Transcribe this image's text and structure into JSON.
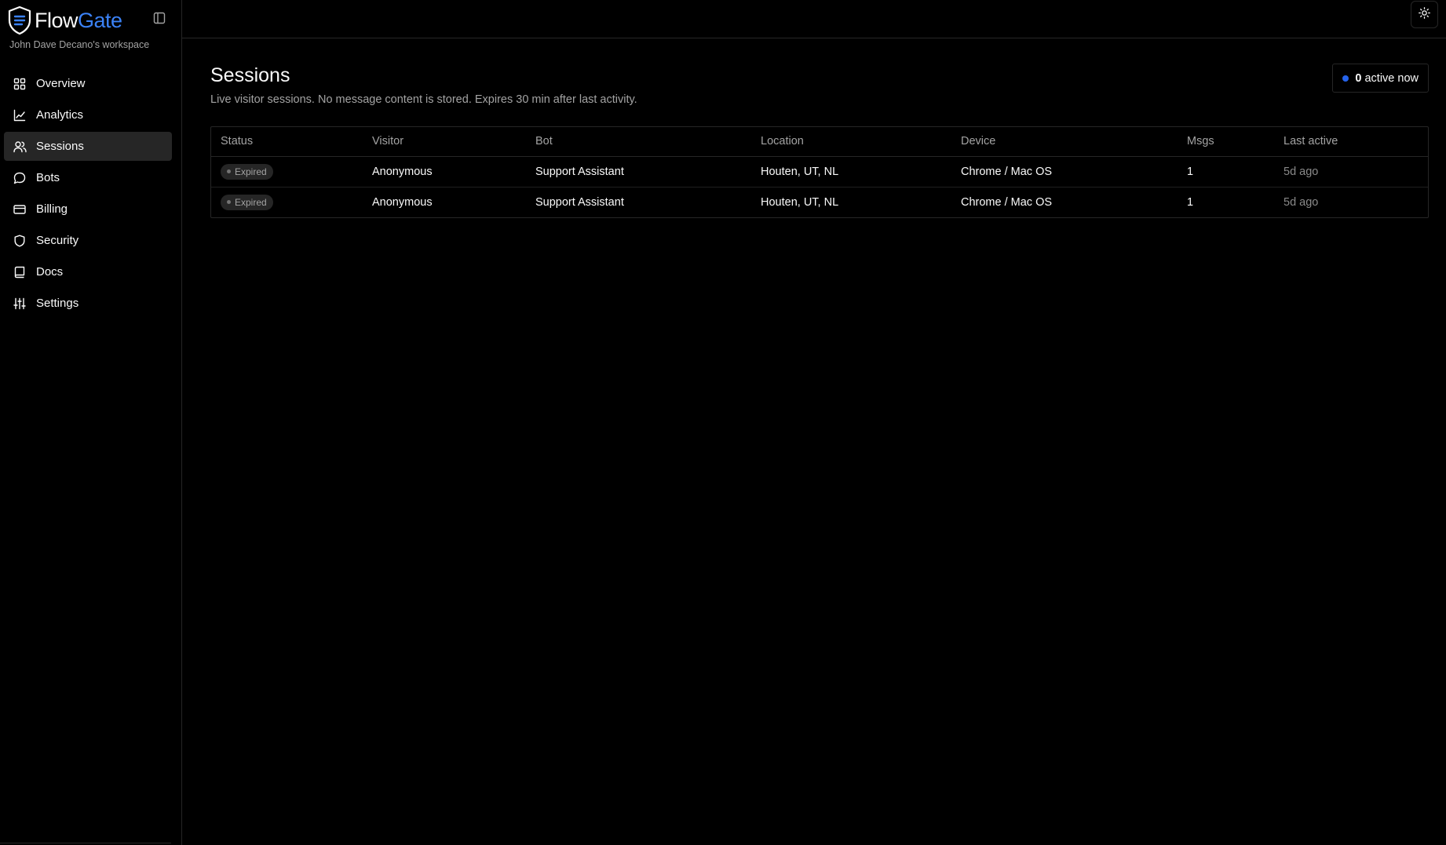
{
  "brand": {
    "name_part1": "Flow",
    "name_part2": "Gate",
    "accent_color": "#3b82f6"
  },
  "workspace": "John Dave Decano's workspace",
  "nav": [
    {
      "label": "Overview",
      "icon": "grid-icon",
      "active": false
    },
    {
      "label": "Analytics",
      "icon": "line-chart-icon",
      "active": false
    },
    {
      "label": "Sessions",
      "icon": "users-icon",
      "active": true
    },
    {
      "label": "Bots",
      "icon": "message-square-icon",
      "active": false
    },
    {
      "label": "Billing",
      "icon": "credit-card-icon",
      "active": false
    },
    {
      "label": "Security",
      "icon": "shield-icon",
      "active": false
    },
    {
      "label": "Docs",
      "icon": "book-icon",
      "active": false
    },
    {
      "label": "Settings",
      "icon": "sliders-icon",
      "active": false
    }
  ],
  "page": {
    "title": "Sessions",
    "description": "Live visitor sessions. No message content is stored. Expires 30 min after last activity.",
    "active_count": "0",
    "active_label": "active now"
  },
  "table": {
    "columns": [
      "Status",
      "Visitor",
      "Bot",
      "Location",
      "Device",
      "Msgs",
      "Last active"
    ],
    "rows": [
      {
        "status": "Expired",
        "visitor": "Anonymous",
        "bot": "Support Assistant",
        "location": "Houten, UT, NL",
        "device": "Chrome / Mac OS",
        "msgs": "1",
        "last_active": "5d ago"
      },
      {
        "status": "Expired",
        "visitor": "Anonymous",
        "bot": "Support Assistant",
        "location": "Houten, UT, NL",
        "device": "Chrome / Mac OS",
        "msgs": "1",
        "last_active": "5d ago"
      }
    ]
  },
  "colors": {
    "background": "#000000",
    "border": "#262626",
    "active_nav": "#262626",
    "status_dot": "#2563eb"
  }
}
